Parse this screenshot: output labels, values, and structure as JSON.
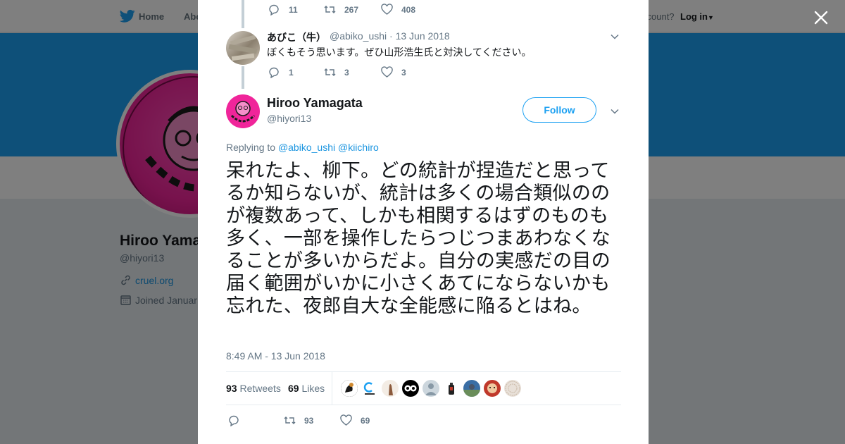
{
  "background": {
    "nav": {
      "home_label": "Home",
      "about_label": "Abo",
      "account_text": "ccount?",
      "login_label": "Log in"
    },
    "profile": {
      "name": "Hiroo Yamaga",
      "handle": "@hiyori13",
      "link": "cruel.org",
      "joined": "Joined Januar"
    },
    "banner_color": "#1da1f2"
  },
  "modal": {
    "prev_tweet_actions": {
      "replies": "11",
      "retweets": "267",
      "likes": "408"
    },
    "reply_tweet": {
      "name": "あびこ（牛）",
      "meta": "@abiko_ushi · 13 Jun 2018",
      "text": "ぼくもそう思います。ぜひ山形浩生氏と対決してください。",
      "replies": "1",
      "retweets": "3",
      "likes": "3"
    },
    "main_tweet": {
      "name": "Hiroo Yamagata",
      "handle": "@hiyori13",
      "follow_label": "Follow",
      "replying_prefix": "Replying to",
      "mention_1": "@abiko_ushi",
      "mention_2": "@kiichiro",
      "text": "呆れたよ、柳下。どの統計が捏造だと思ってるか知らないが、統計は多くの場合類似ののが複数あって、しかも相関するはずのものも多く、一部を操作したらつじつまあわなくなることが多いからだよ。自分の実感だの目の届く範囲がいかに小さくあてにならないかも忘れた、夜郎自大な全能感に陥るとはね。",
      "timestamp": "8:49 AM - 13 Jun 2018",
      "retweet_count": "93",
      "retweets_label": "Retweets",
      "like_count": "69",
      "likes_label": "Likes",
      "actions": {
        "replies": "",
        "retweets": "93",
        "likes": "69"
      }
    }
  },
  "colors": {
    "accent": "#1da1f2",
    "link": "#1b95e0",
    "muted": "#657786"
  }
}
